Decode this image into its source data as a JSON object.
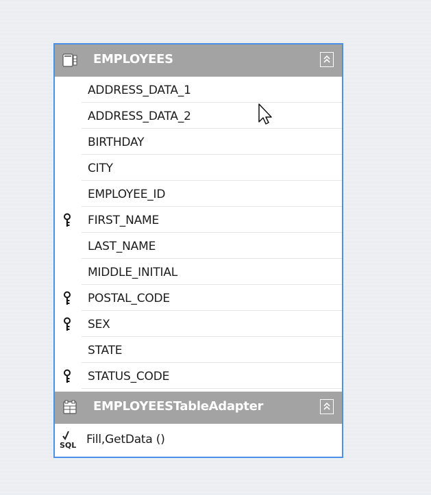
{
  "table": {
    "title": "EMPLOYEES",
    "columns": [
      {
        "name": "ADDRESS_DATA_1",
        "key": false
      },
      {
        "name": "ADDRESS_DATA_2",
        "key": false
      },
      {
        "name": "BIRTHDAY",
        "key": false
      },
      {
        "name": "CITY",
        "key": false
      },
      {
        "name": "EMPLOYEE_ID",
        "key": false
      },
      {
        "name": "FIRST_NAME",
        "key": true
      },
      {
        "name": "LAST_NAME",
        "key": false
      },
      {
        "name": "MIDDLE_INITIAL",
        "key": false
      },
      {
        "name": "POSTAL_CODE",
        "key": true
      },
      {
        "name": "SEX",
        "key": true
      },
      {
        "name": "STATE",
        "key": false
      },
      {
        "name": "STATUS_CODE",
        "key": true
      }
    ]
  },
  "adapter": {
    "title": "EMPLOYEESTableAdapter",
    "method_label": "Fill,GetData ()",
    "method_icon_text": "SQL"
  },
  "icons": {
    "table": "datatable-icon",
    "adapter": "tableadapter-icon",
    "key": "primary-key-icon",
    "collapse": "double-chevron-up-icon",
    "sql": "sql-query-icon",
    "cursor": "mouse-pointer-icon"
  },
  "colors": {
    "header": "#a3a3a3",
    "selection_border": "#4a90e8"
  }
}
